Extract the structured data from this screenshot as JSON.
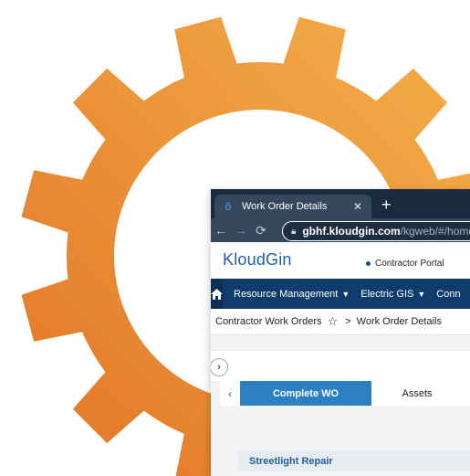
{
  "decoration": {
    "gear_icon": "gear-icon",
    "gear_colors": {
      "light": "#f2ae48",
      "dark": "#e47828"
    }
  },
  "browser": {
    "tab_title": "Work Order Details",
    "new_tab_glyph": "+",
    "close_glyph": "✕",
    "url_host": "gbhf.kloudgin.com",
    "url_path": "/kgweb/#/home?pag"
  },
  "app": {
    "logo_text": "KloudGin",
    "portal_label": "Contractor Portal",
    "nav": {
      "items": [
        "Resource Management",
        "Electric GIS",
        "Conn"
      ]
    },
    "breadcrumb": {
      "parent": "Contractor Work Orders",
      "separator": ">",
      "current": "Work Order Details"
    },
    "tabs": {
      "active": "Complete WO",
      "second": "Assets"
    },
    "section_title": "Streetlight Repair"
  },
  "colors": {
    "nav_bg": "#0f3c6b",
    "accent": "#2b7fc3",
    "browser_dark": "#1b2a3d"
  }
}
